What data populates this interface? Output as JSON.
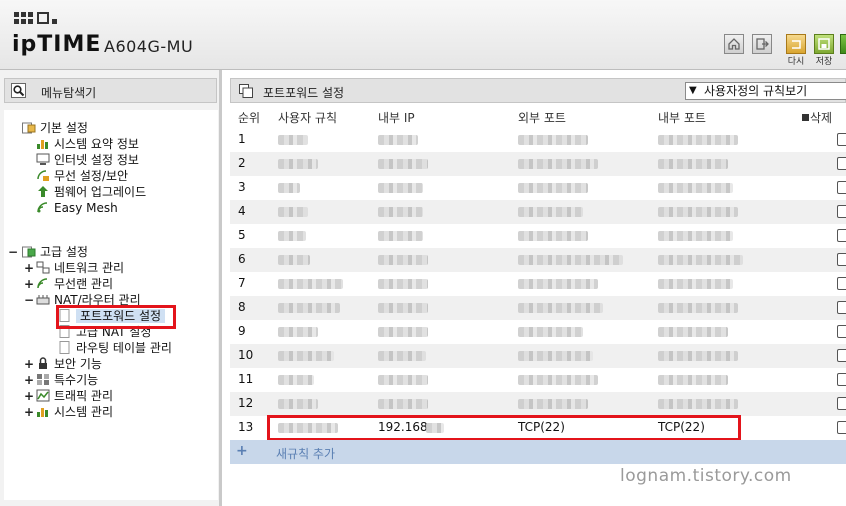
{
  "header": {
    "brand": "ipTIME",
    "model": "A604G-MU",
    "buttons": [
      {
        "label": ""
      },
      {
        "label": ""
      },
      {
        "label": "다시"
      },
      {
        "label": "저장"
      }
    ]
  },
  "left": {
    "title": "메뉴탐색기",
    "basic": {
      "label": "기본 설정",
      "items": [
        "시스템 요약 정보",
        "인터넷 설정 정보",
        "무선 설정/보안",
        "펌웨어 업그레이드",
        "Easy Mesh"
      ]
    },
    "advanced": {
      "label": "고급 설정",
      "items": [
        "네트워크 관리",
        "무선랜 관리",
        "NAT/라우터 관리"
      ],
      "nat_children": [
        "포트포워드 설정",
        "고급 NAT 설정",
        "라우팅 테이블 관리"
      ],
      "more": [
        "보안 기능",
        "특수기능",
        "트래픽 관리",
        "시스템 관리"
      ]
    }
  },
  "main": {
    "title": "포트포워드 설정",
    "dropdown_value": "사용자정의 규칙보기",
    "columns": [
      "순위",
      "사용자 규칙",
      "내부 IP",
      "외부 포트",
      "내부 포트",
      "삭제"
    ],
    "rows": [
      {
        "n": "1"
      },
      {
        "n": "2"
      },
      {
        "n": "3"
      },
      {
        "n": "4"
      },
      {
        "n": "5"
      },
      {
        "n": "6"
      },
      {
        "n": "7"
      },
      {
        "n": "8"
      },
      {
        "n": "9"
      },
      {
        "n": "10"
      },
      {
        "n": "11"
      },
      {
        "n": "12"
      },
      {
        "n": "13",
        "ip": "192.168",
        "ext": "TCP(22)",
        "int": "TCP(22)"
      }
    ],
    "add_label": "새규칙 추가",
    "add_icon": "+"
  },
  "watermark": "lognam.tistory.com",
  "colors": {
    "highlight": "#e3141b",
    "add_row": "#c8d7ea",
    "link": "#5a7fb3"
  }
}
